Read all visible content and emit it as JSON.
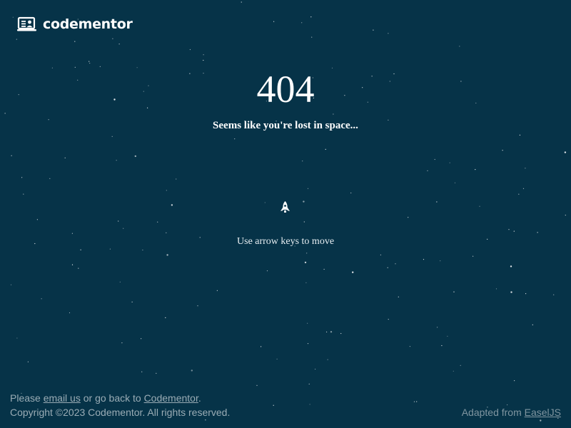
{
  "brand": {
    "name": "codementor",
    "icon": "codementor-logo-icon"
  },
  "error": {
    "code": "404",
    "message": "Seems like you're lost in space...",
    "hint": "Use arrow keys to move"
  },
  "game": {
    "player_icon": "rocket-icon"
  },
  "footer": {
    "please": "Please ",
    "email_link": "email us",
    "or_go_back": " or go back to ",
    "home_link": "Codementor",
    "period": ".",
    "copyright": "Copyright ©2023 Codementor. All rights reserved.",
    "adapted_from": "Adapted from ",
    "easeljs_link": "EaselJS"
  },
  "colors": {
    "background": "#063348",
    "text": "#ffffff",
    "footer_text": "#9aacb5",
    "star": "#ffffff"
  }
}
